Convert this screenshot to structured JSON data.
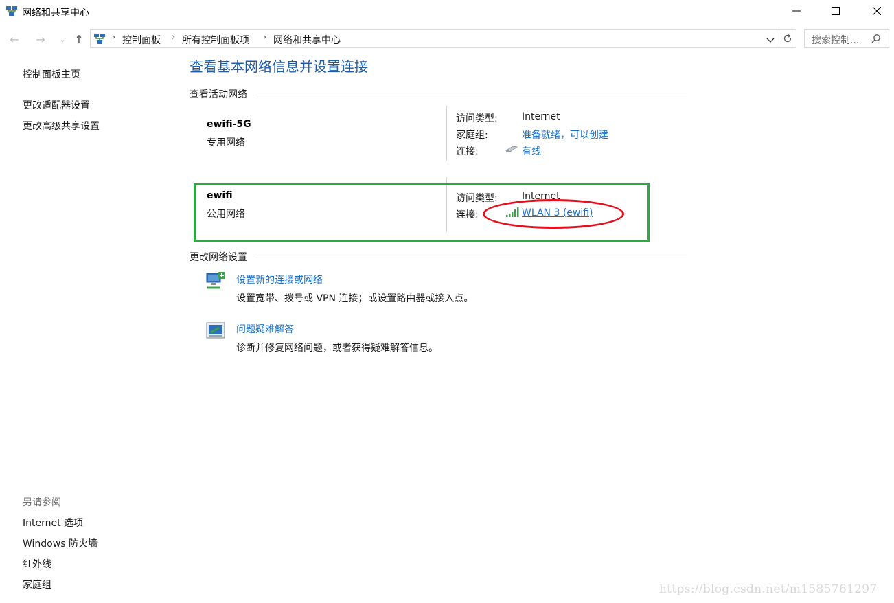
{
  "window": {
    "title": "网络和共享中心",
    "minimize_label": "—",
    "maximize_label": "☐",
    "close_label": "✕"
  },
  "navbar": {
    "breadcrumb": [
      "控制面板",
      "所有控制面板项",
      "网络和共享中心"
    ],
    "search_placeholder": "搜索控制..."
  },
  "sidebar": {
    "links": [
      "控制面板主页",
      "更改适配器设置",
      "更改高级共享设置"
    ],
    "see_also_title": "另请参阅",
    "see_also": [
      "Internet 选项",
      "Windows 防火墙",
      "红外线",
      "家庭组"
    ]
  },
  "main": {
    "title": "查看基本网络信息并设置连接",
    "active_networks_heading": "查看活动网络",
    "networks": [
      {
        "name": "ewifi-5G",
        "type": "专用网络",
        "access_label": "访问类型:",
        "access_value": "Internet",
        "homegroup_label": "家庭组:",
        "homegroup_value": "准备就绪，可以创建",
        "connection_label": "连接:",
        "connection_value": "有线"
      },
      {
        "name": "ewifi",
        "type": "公用网络",
        "access_label": "访问类型:",
        "access_value": "Internet",
        "connection_label": "连接:",
        "connection_value": "WLAN 3 (ewifi)"
      }
    ],
    "change_settings_heading": "更改网络设置",
    "tasks": [
      {
        "link": "设置新的连接或网络",
        "desc": "设置宽带、拨号或 VPN 连接；或设置路由器或接入点。"
      },
      {
        "link": "问题疑难解答",
        "desc": "诊断并修复网络问题，或者获得疑难解答信息。"
      }
    ]
  },
  "watermark": "https://blog.csdn.net/m1585761297",
  "colors": {
    "link": "#1b73c9",
    "title": "#1f5ca8",
    "highlight_box": "#27ad3c",
    "highlight_ellipse": "#e3101d"
  },
  "icons": [
    "network-center-icon",
    "back-arrow-icon",
    "forward-arrow-icon",
    "recent-chevron-icon",
    "up-arrow-icon",
    "refresh-icon",
    "search-icon",
    "ethernet-icon",
    "wifi-signal-icon",
    "new-connection-icon",
    "troubleshoot-icon"
  ]
}
